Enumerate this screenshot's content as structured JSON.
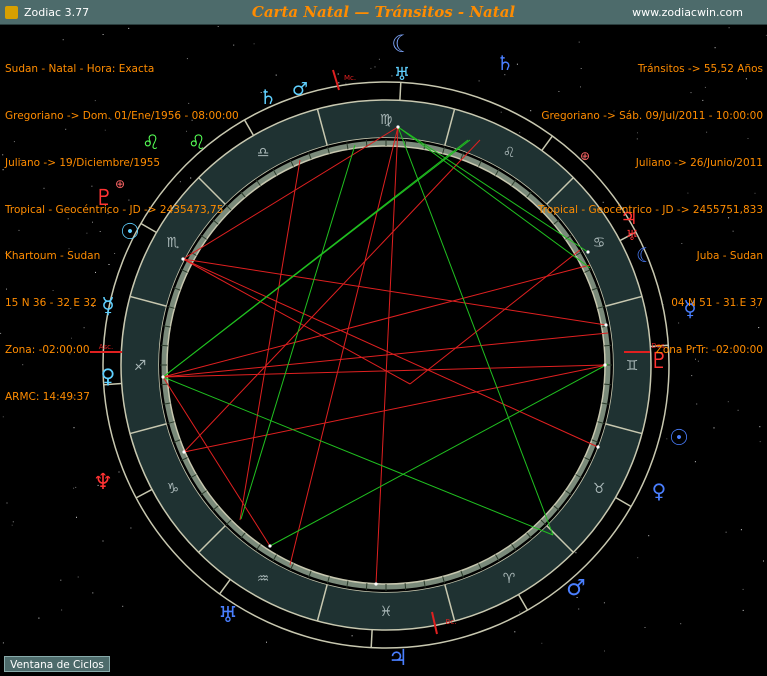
{
  "window": {
    "app_name": "Zodiac 3.77",
    "title": "Carta Natal — Tránsitos - Natal",
    "url": "www.zodiacwin.com"
  },
  "natal": {
    "lines": [
      "Sudan - Natal - Hora: Exacta",
      "Gregoriano -> Dom. 01/Ene/1956 - 08:00:00",
      "Juliano -> 19/Diciembre/1955",
      "Tropical - Geocéntrico - JD -> 2435473,75",
      "Khartoum - Sudan",
      "15 N 36 - 32 E 32",
      "Zona: -02:00:00",
      "ARMC: 14:49:37"
    ]
  },
  "transits": {
    "lines": [
      "Tránsitos -> 55,52 Años",
      "Gregoriano -> Sáb. 09/Jul/2011 - 10:00:00",
      "Juliano -> 26/Junio/2011",
      "Tropical - Geocéntrico - JD -> 2455751,833",
      "Juba - Sudan",
      "04 N 51 - 31 E 37",
      "Zona PrTr: -02:00:00"
    ]
  },
  "angles": {
    "asc": "Asc.",
    "des": "Des.",
    "mc": "Mc.",
    "bc": "Bc."
  },
  "signs": [
    "♈",
    "♉",
    "♊",
    "♋",
    "♌",
    "♍",
    "♎",
    "♏",
    "♐",
    "♑",
    "♒",
    "♓"
  ],
  "planets": [
    {
      "name": "moon",
      "glyph": "☾",
      "color": "#7fa8ff"
    },
    {
      "name": "uranus",
      "glyph": "♅",
      "color": "#5fd0ff"
    },
    {
      "name": "saturn",
      "glyph": "♄",
      "color": "#5fd0ff"
    },
    {
      "name": "mars",
      "glyph": "♂",
      "color": "#5fd0ff"
    },
    {
      "name": "saturn-transit",
      "glyph": "♄",
      "color": "#4a7fff"
    },
    {
      "name": "leo",
      "glyph": "♌",
      "color": "#55ff55"
    },
    {
      "name": "leo-transit",
      "glyph": "♌",
      "color": "#55ff55"
    },
    {
      "name": "earth",
      "glyph": "⊕",
      "color": "#ff6666"
    },
    {
      "name": "pluto",
      "glyph": "♇",
      "color": "#ff3333"
    },
    {
      "name": "sun",
      "glyph": "☉",
      "color": "#5fd0ff"
    },
    {
      "name": "mercury",
      "glyph": "☿",
      "color": "#5fd0ff"
    },
    {
      "name": "venus",
      "glyph": "♀",
      "color": "#5fd0ff"
    },
    {
      "name": "neptune",
      "glyph": "♆",
      "color": "#ff3333"
    },
    {
      "name": "jupiter",
      "glyph": "♃",
      "color": "#4a7fff"
    },
    {
      "name": "uranus-bottom",
      "glyph": "♅",
      "color": "#4a7fff"
    },
    {
      "name": "mars-transit",
      "glyph": "♂",
      "color": "#4a7fff"
    },
    {
      "name": "venus-transit",
      "glyph": "♀",
      "color": "#4a7fff"
    },
    {
      "name": "sun-transit",
      "glyph": "☉",
      "color": "#4a7fff"
    },
    {
      "name": "mercury-transit",
      "glyph": "☿",
      "color": "#4a7fff"
    },
    {
      "name": "moon-transit",
      "glyph": "☾",
      "color": "#4a7fff"
    },
    {
      "name": "pluto-transit",
      "glyph": "♇",
      "color": "#ff3333"
    },
    {
      "name": "jupiter-transit",
      "glyph": "♃",
      "color": "#ff3333"
    },
    {
      "name": "earth-transit",
      "glyph": "⊕",
      "color": "#ff6666"
    },
    {
      "name": "uranus-transit",
      "glyph": "♅",
      "color": "#ff3333"
    }
  ],
  "button": {
    "ciclos": "Ventana de Ciclos"
  }
}
